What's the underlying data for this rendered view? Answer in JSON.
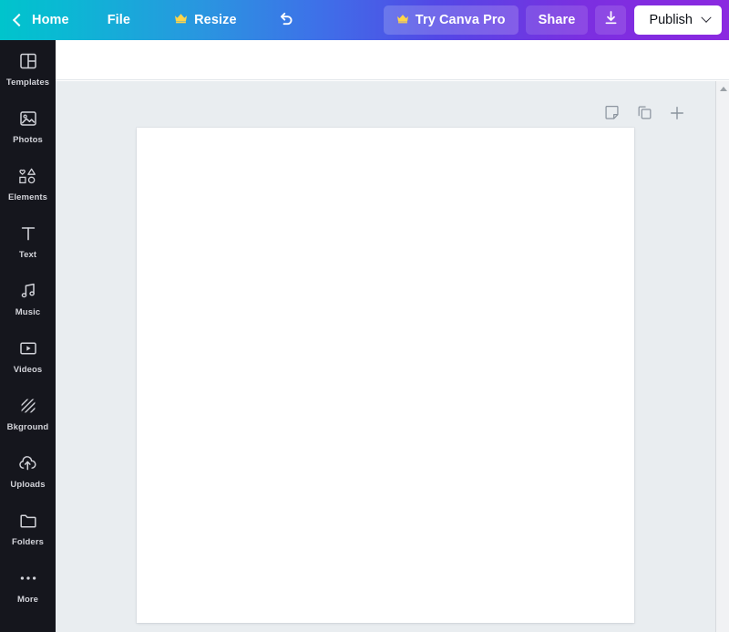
{
  "header": {
    "back_icon": "chevron-left-icon",
    "home_label": "Home",
    "file_label": "File",
    "resize_crown_icon": "crown-icon",
    "resize_label": "Resize",
    "undo_icon": "undo-icon",
    "try_pro_crown_icon": "crown-icon",
    "try_pro_label": "Try Canva Pro",
    "share_label": "Share",
    "download_icon": "download-icon",
    "publish_label": "Publish",
    "publish_caret_icon": "chevron-down-icon",
    "gradient_start": "#00c4cc",
    "gradient_mid": "#3d72e8",
    "gradient_end": "#8b29e0"
  },
  "sidebar": {
    "background": "#15161d",
    "items": [
      {
        "label": "Templates",
        "icon": "templates-icon"
      },
      {
        "label": "Photos",
        "icon": "photos-icon"
      },
      {
        "label": "Elements",
        "icon": "elements-icon"
      },
      {
        "label": "Text",
        "icon": "text-icon"
      },
      {
        "label": "Music",
        "icon": "music-icon"
      },
      {
        "label": "Videos",
        "icon": "videos-icon"
      },
      {
        "label": "Bkground",
        "icon": "background-icon"
      },
      {
        "label": "Uploads",
        "icon": "uploads-icon"
      },
      {
        "label": "Folders",
        "icon": "folders-icon"
      },
      {
        "label": "More",
        "icon": "more-icon"
      }
    ]
  },
  "canvas": {
    "tools": [
      {
        "name": "add-note-button",
        "icon": "sticky-note-icon"
      },
      {
        "name": "duplicate-page-button",
        "icon": "duplicate-icon"
      },
      {
        "name": "add-page-button",
        "icon": "plus-icon"
      }
    ],
    "page_background": "#ffffff",
    "workspace_background": "#e9edf0"
  },
  "scrollbar": {
    "up_arrow_icon": "triangle-up-icon"
  }
}
